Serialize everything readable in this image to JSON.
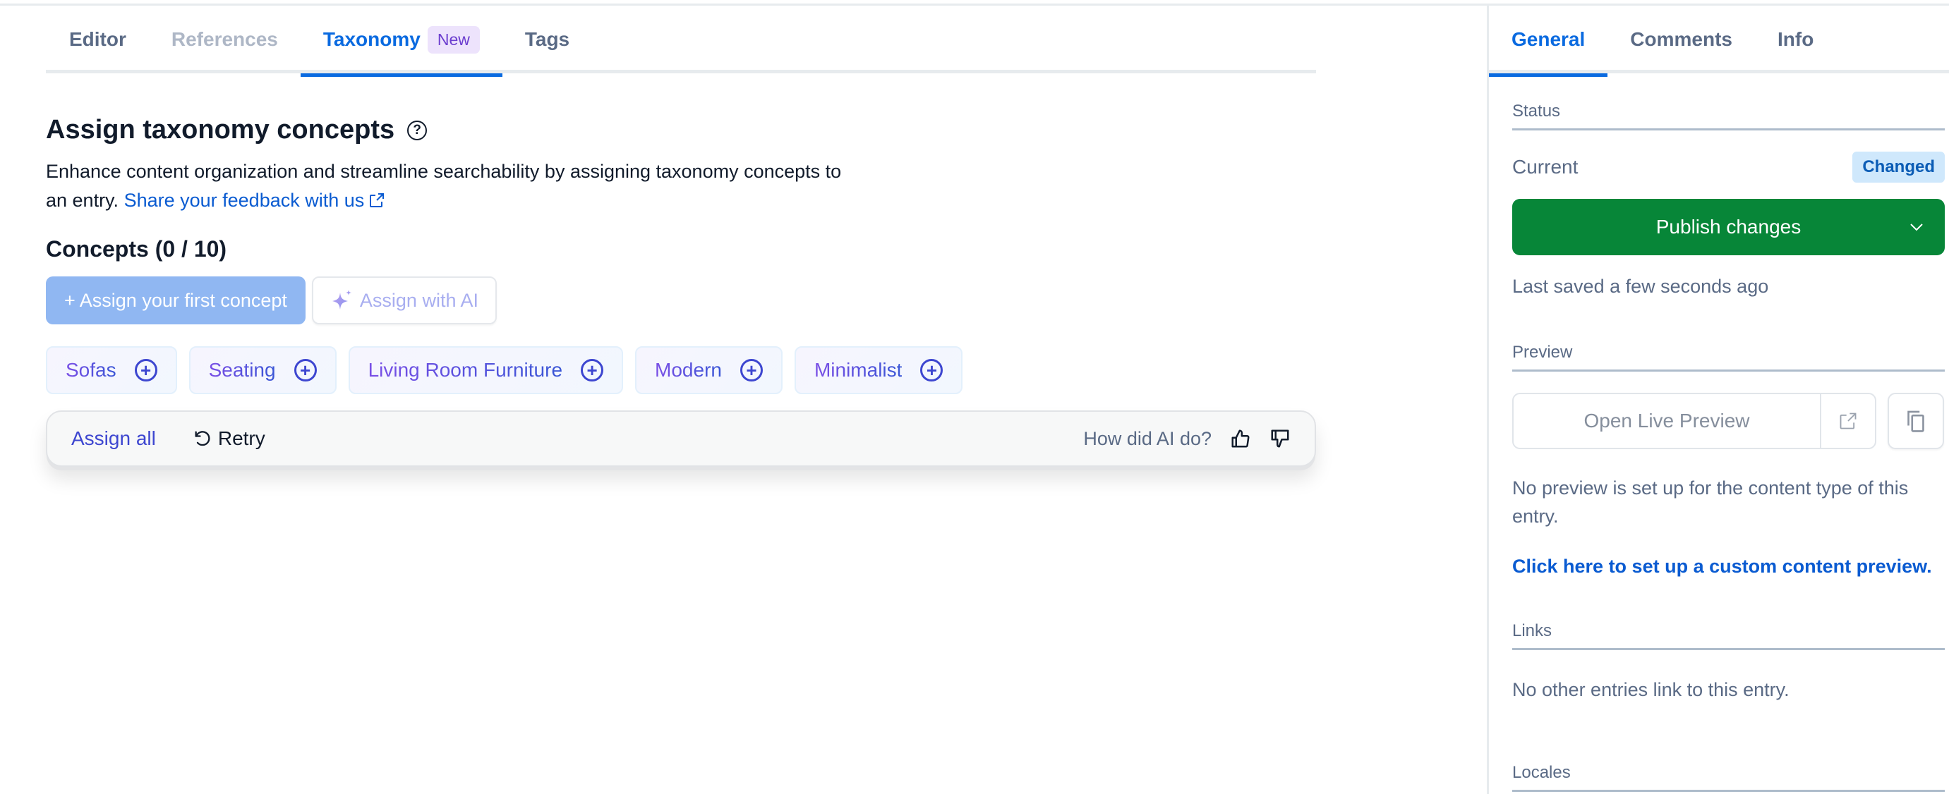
{
  "main": {
    "tabs": [
      {
        "label": "Editor",
        "state": "normal"
      },
      {
        "label": "References",
        "state": "disabled"
      },
      {
        "label": "Taxonomy",
        "state": "active",
        "badge": "New"
      },
      {
        "label": "Tags",
        "state": "normal"
      }
    ],
    "heading": "Assign taxonomy concepts",
    "description": "Enhance content organization and streamline searchability by assigning taxonomy concepts to an entry.",
    "feedback_link": "Share your feedback with us",
    "concepts_title": "Concepts (0 / 10)",
    "assign_first_button": "+ Assign your first concept",
    "assign_ai_button": "Assign with AI",
    "suggested_concepts": [
      {
        "label": "Sofas"
      },
      {
        "label": "Seating"
      },
      {
        "label": "Living Room Furniture"
      },
      {
        "label": "Modern"
      },
      {
        "label": "Minimalist"
      }
    ],
    "ai_bar": {
      "assign_all": "Assign all",
      "retry": "Retry",
      "feedback_prompt": "How did AI do?"
    }
  },
  "sidebar": {
    "tabs": [
      {
        "label": "General",
        "state": "active"
      },
      {
        "label": "Comments",
        "state": "normal"
      },
      {
        "label": "Info",
        "state": "normal"
      }
    ],
    "status": {
      "label": "Status",
      "current_label": "Current",
      "current_badge": "Changed",
      "publish_button": "Publish changes",
      "last_saved": "Last saved a few seconds ago"
    },
    "preview": {
      "label": "Preview",
      "open_button": "Open Live Preview",
      "no_preview_text": "No preview is set up for the content type of this entry.",
      "setup_link": "Click here to set up a custom content preview."
    },
    "links": {
      "label": "Links",
      "empty_text": "No other entries link to this entry."
    },
    "locales": {
      "label": "Locales"
    }
  },
  "colors": {
    "accent_blue": "#0a6ae0",
    "publish_green": "#078638",
    "badge_changed_bg": "#cfe8fc",
    "ai_purple": "#3d46d0"
  }
}
